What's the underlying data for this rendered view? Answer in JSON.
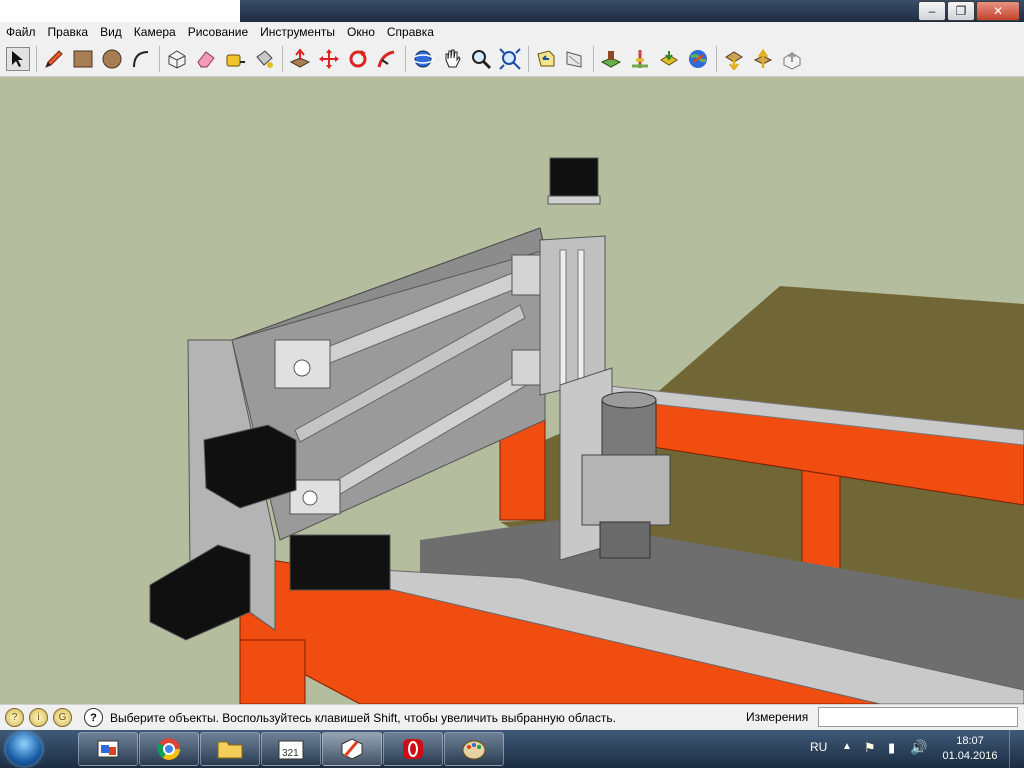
{
  "window": {
    "minimize_glyph": "–",
    "maximize_glyph": "❐",
    "close_glyph": "✕"
  },
  "menu": [
    "Файл",
    "Правка",
    "Вид",
    "Камера",
    "Рисование",
    "Инструменты",
    "Окно",
    "Справка"
  ],
  "toolbar": {
    "groups": [
      [
        "select-tool",
        "pencil-line-tool",
        "rectangle-tool",
        "circle-tool",
        "arc-tool"
      ],
      [
        "make-component-tool",
        "eraser-tool",
        "tape-measure-tool",
        "paint-bucket-tool"
      ],
      [
        "push-pull-tool",
        "move-tool",
        "rotate-tool",
        "follow-me-tool"
      ],
      [
        "orbit-tool",
        "pan-tool",
        "zoom-tool",
        "zoom-extents-tool"
      ],
      [
        "previous-view-tool",
        "next-view-tool"
      ],
      [
        "add-location-tool",
        "toggle-terrain-tool",
        "get-models-tool",
        "google-earth-tool"
      ],
      [
        "get-models-warehouse-tool",
        "share-model-tool",
        "share-component-tool"
      ]
    ],
    "selected": "select-tool"
  },
  "status": {
    "hint": "Выберите объекты. Воспользуйтесь клавишей Shift, чтобы увеличить выбранную область.",
    "measurements_label": "Измерения",
    "measurements_value": ""
  },
  "taskbar": {
    "apps": [
      "file-explorer-app",
      "chrome-app",
      "folder-app",
      "media-player-app",
      "sketchup-app",
      "opera-app",
      "paint-app"
    ],
    "active": "sketchup-app",
    "language": "RU",
    "time": "18:07",
    "date": "01.04.2016"
  },
  "colors": {
    "sky": "#b4bd9e",
    "table_surface": "#716736",
    "frame_orange": "#f24d11",
    "rail_silver": "#c9c9c9",
    "plate_gray": "#c0c0c0",
    "motor_black": "#101010",
    "table_gray": "#6e6e6e"
  }
}
